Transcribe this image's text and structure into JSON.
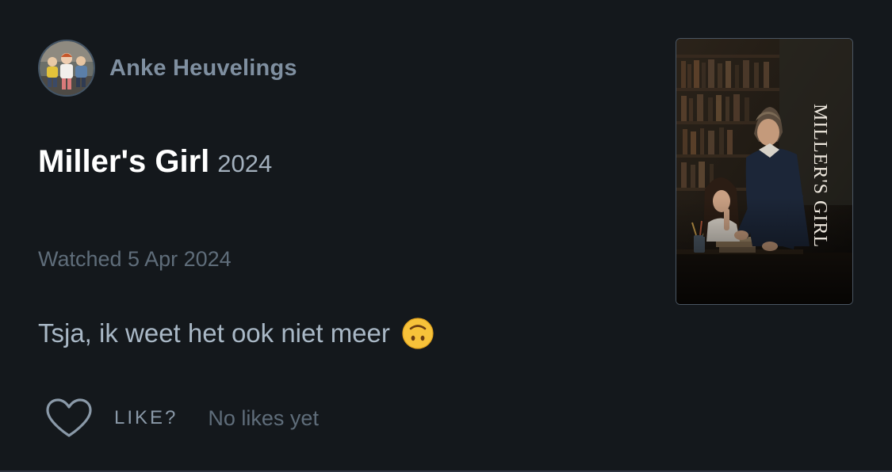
{
  "review": {
    "author_name": "Anke Heuvelings",
    "film_title": "Miller's Girl",
    "film_year": "2024",
    "watched_label": "Watched 5 Apr 2024",
    "text": "Tsja, ik weet het ook niet meer",
    "emoji_name": "upside-down-face"
  },
  "likes": {
    "like_label": "LIKE?",
    "status": "No likes yet",
    "liked": false
  },
  "poster": {
    "title_text": "MILLER'S GIRL"
  },
  "icons": {
    "heart": "heart-outline-icon",
    "emoji": "upside-down-face-icon"
  },
  "colors": {
    "background": "#14181c",
    "title": "#ffffff",
    "author": "#7f8fa0",
    "muted": "#5f6d7a",
    "body_text": "#a9b8c6"
  }
}
